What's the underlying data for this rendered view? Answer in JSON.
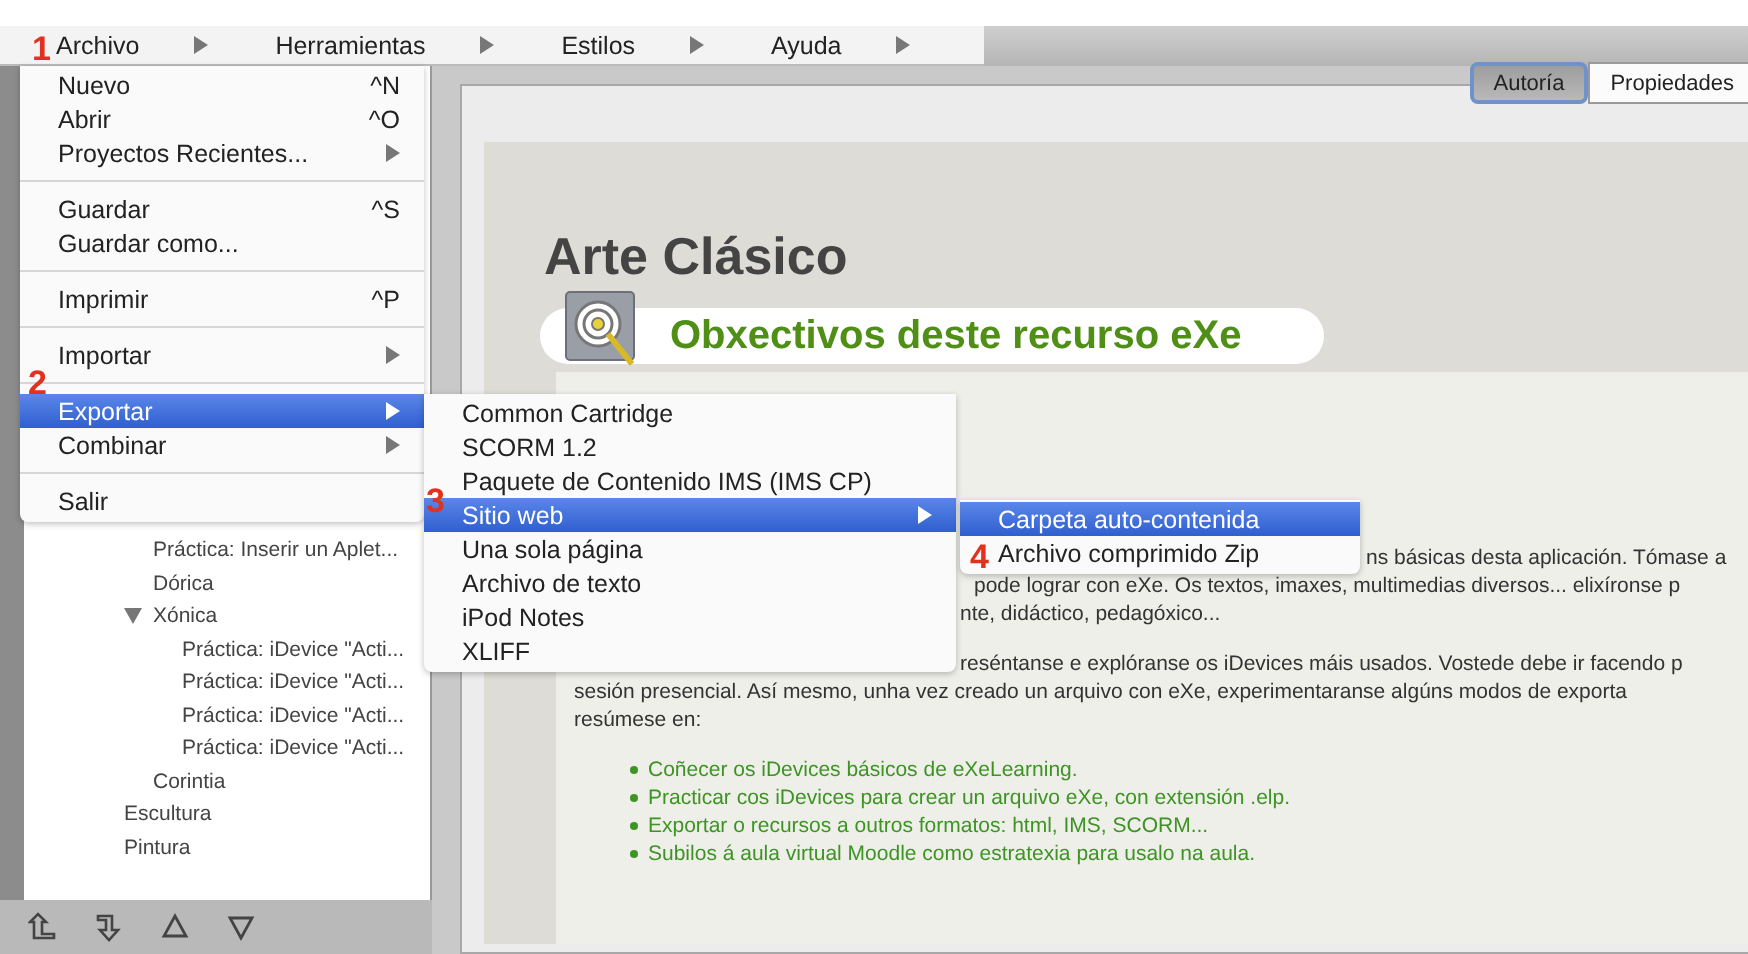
{
  "menubar": [
    {
      "label": "Archivo"
    },
    {
      "label": "Herramientas"
    },
    {
      "label": "Estilos"
    },
    {
      "label": "Ayuda"
    }
  ],
  "open_menus": [
    {
      "items": [
        {
          "kind": "item",
          "label": "Nuevo",
          "shortcut": "^N",
          "has_submenu": false,
          "selected": false
        },
        {
          "kind": "item",
          "label": "Abrir",
          "shortcut": "^O",
          "has_submenu": false,
          "selected": false
        },
        {
          "kind": "item",
          "label": "Proyectos Recientes...",
          "has_submenu": true,
          "selected": false
        },
        {
          "kind": "separator"
        },
        {
          "kind": "item",
          "label": "Guardar",
          "shortcut": "^S",
          "has_submenu": false,
          "selected": false
        },
        {
          "kind": "item",
          "label": "Guardar como...",
          "has_submenu": false,
          "selected": false
        },
        {
          "kind": "separator"
        },
        {
          "kind": "item",
          "label": "Imprimir",
          "shortcut": "^P",
          "has_submenu": false,
          "selected": false
        },
        {
          "kind": "separator"
        },
        {
          "kind": "item",
          "label": "Importar",
          "has_submenu": true,
          "selected": false
        },
        {
          "kind": "separator"
        },
        {
          "kind": "item",
          "label": "Exportar",
          "has_submenu": true,
          "selected": true
        },
        {
          "kind": "item",
          "label": "Combinar",
          "has_submenu": true,
          "selected": false
        },
        {
          "kind": "separator"
        },
        {
          "kind": "item",
          "label": "Salir",
          "has_submenu": false,
          "selected": false
        }
      ]
    },
    {
      "items": [
        {
          "kind": "item",
          "label": "Common Cartridge",
          "has_submenu": false,
          "selected": false
        },
        {
          "kind": "item",
          "label": "SCORM 1.2",
          "has_submenu": false,
          "selected": false
        },
        {
          "kind": "item",
          "label": "Paquete de Contenido IMS (IMS CP)",
          "has_submenu": false,
          "selected": false
        },
        {
          "kind": "item",
          "label": "Sitio web",
          "has_submenu": true,
          "selected": true
        },
        {
          "kind": "item",
          "label": "Una sola página",
          "has_submenu": false,
          "selected": false
        },
        {
          "kind": "item",
          "label": "Archivo de texto",
          "has_submenu": false,
          "selected": false
        },
        {
          "kind": "item",
          "label": "iPod Notes",
          "has_submenu": false,
          "selected": false
        },
        {
          "kind": "item",
          "label": "XLIFF",
          "has_submenu": false,
          "selected": false
        }
      ]
    },
    {
      "items": [
        {
          "kind": "item",
          "label": "Carpeta auto-contenida",
          "has_submenu": false,
          "selected": true
        },
        {
          "kind": "item",
          "label": "Archivo comprimido Zip",
          "has_submenu": false,
          "selected": false
        }
      ]
    }
  ],
  "step_markers": [
    {
      "label": "1"
    },
    {
      "label": "2"
    },
    {
      "label": "3"
    },
    {
      "label": "4"
    }
  ],
  "outline": {
    "items": [
      {
        "children": [
          {
            "label": "Práctica: Inserir un Aplet..."
          },
          {
            "label": "Dórica"
          },
          {
            "label": "Xónica",
            "expanded": true,
            "children": [
              {
                "label": "Práctica: iDevice \"Acti..."
              },
              {
                "label": "Práctica: iDevice \"Acti..."
              },
              {
                "label": "Práctica: iDevice \"Acti..."
              },
              {
                "label": "Práctica: iDevice \"Acti..."
              }
            ]
          },
          {
            "label": "Corintia"
          }
        ]
      },
      {
        "label": "Escultura"
      },
      {
        "label": "Pintura"
      }
    ]
  },
  "tabs": [
    {
      "label": "Autoría",
      "selected": true
    },
    {
      "label": "Propiedades",
      "selected": false
    }
  ],
  "content": {
    "title": "Arte Clásico",
    "idevice_title": "Obxectivos deste recurso eXe",
    "text_lines": [
      "ns básicas desta aplicación. Tómase a",
      "pode lograr con eXe. Os textos, imaxes, multimedias diversos... elixíronse p",
      "nte, didáctico, pedagóxico...",
      "reséntanse e explóranse os iDevices máis usados. Vostede debe ir facendo p",
      "sesión presencial. Así mesmo, unha vez creado un arquivo con eXe, experimentaranse algúns modos de exporta",
      "resúmese en:"
    ],
    "bullets": [
      "Coñecer os iDevices básicos de eXeLearning.",
      "Practicar cos iDevices para crear un arquivo eXe, con extensión .elp.",
      "Exportar o recursos a outros formatos: html, IMS, SCORM...",
      "Subilos á aula virtual Moodle como estratexia para usalo na aula."
    ]
  }
}
